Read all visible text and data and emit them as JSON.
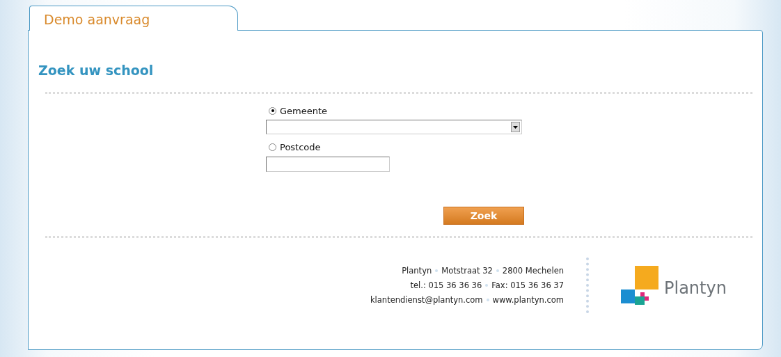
{
  "tab": {
    "label": "Demo aanvraag",
    "selected": true
  },
  "heading": "Zoek uw school",
  "options": [
    {
      "kind": "dropdown",
      "label": "Gemeente",
      "selected": true
    },
    {
      "kind": "text",
      "label": "Postcode",
      "selected": false
    }
  ],
  "search_button": "Zoek",
  "footer": {
    "lines": [
      [
        "Plantyn",
        "Motstraat 32",
        "2800 Mechelen"
      ],
      [
        "tel.: 015 36 36 36",
        "Fax: 015 36 36 37"
      ],
      [
        "klantendienst@plantyn.com",
        "www.plantyn.com"
      ]
    ],
    "logo_text": "Plantyn"
  }
}
